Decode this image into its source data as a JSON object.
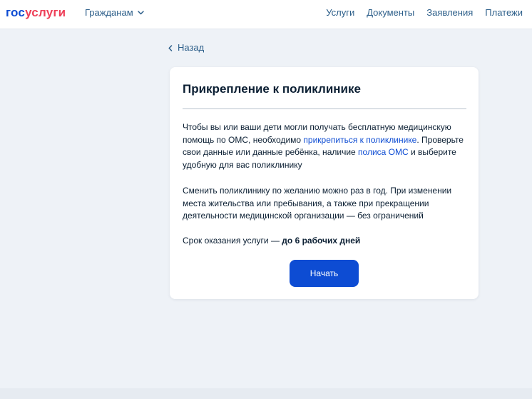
{
  "header": {
    "logo_part1": "гос",
    "logo_part2": "услуги",
    "audience_label": "Гражданам",
    "nav": [
      "Услуги",
      "Документы",
      "Заявления",
      "Платежи"
    ]
  },
  "back_label": "Назад",
  "card": {
    "title": "Прикрепление к поликлинике",
    "p1_before": "Чтобы вы или ваши дети могли получать бесплатную медицинскую помощь по ОМС, необходимо ",
    "p1_link1": "прикрепиться к поликлинике",
    "p1_middle": ". Проверьте свои данные или данные ребёнка, наличие ",
    "p1_link2": "полиса ОМС",
    "p1_after": " и выберите удобную для вас поликлинику",
    "p2": "Сменить поликлинику по желанию можно раз в год. При изменении места жительства или пребывания, а также при прекращении деятельности медицинской организации — без ограничений",
    "p3_prefix": "Срок оказания услуги — ",
    "p3_bold": "до 6 рабочих дней",
    "button_label": "Начать"
  },
  "colors": {
    "brand_blue": "#0d4cd3",
    "brand_red": "#ee3f58",
    "link": "#0d4cd3",
    "nav_text": "#2d5f8a",
    "page_bg": "#eef2f7"
  },
  "icons": {
    "audience_dropdown": "chevron-down-icon",
    "back": "chevron-left-icon"
  }
}
